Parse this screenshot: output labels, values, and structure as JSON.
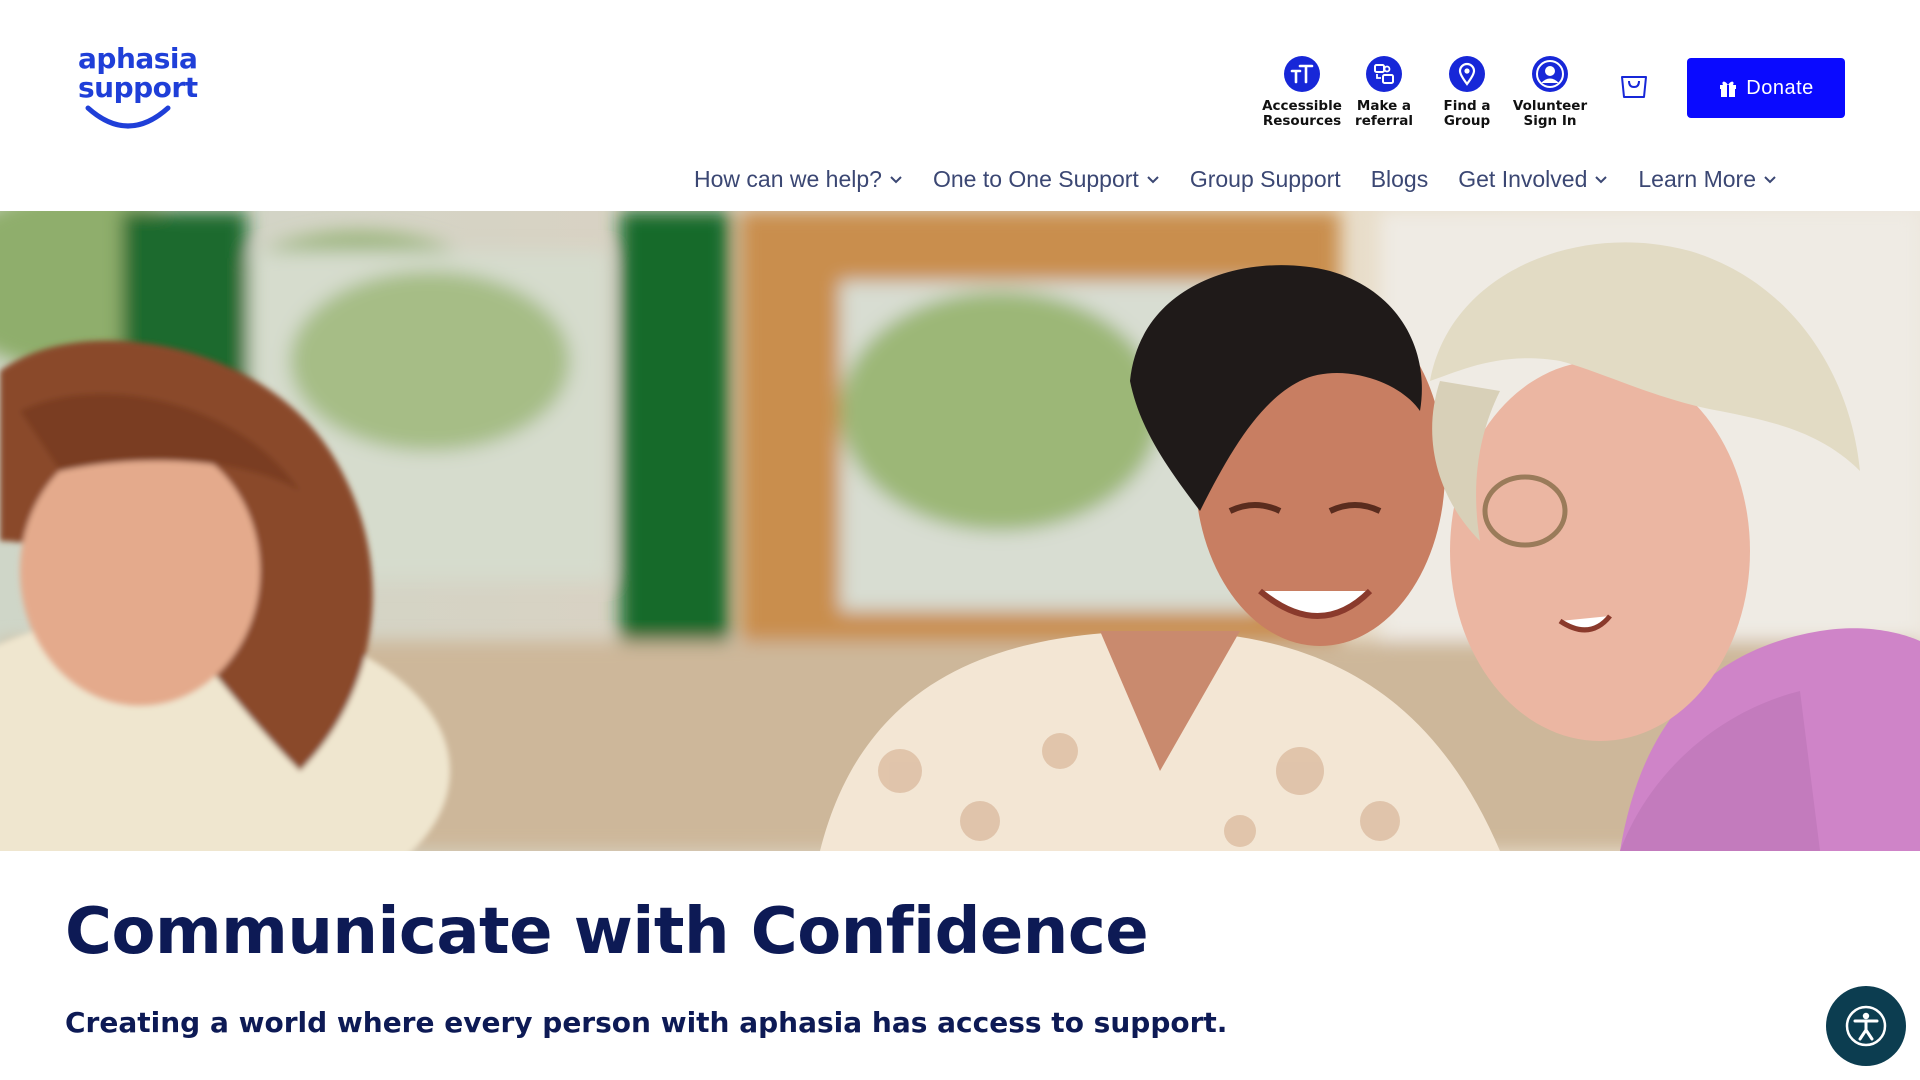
{
  "logo": {
    "line1": "aphasia",
    "line2": "support",
    "color": "#1f3fd8"
  },
  "utility_links": [
    {
      "label": "Accessible\nResources",
      "icon": "text-size-icon"
    },
    {
      "label": "Make a\nreferral",
      "icon": "referral-icon"
    },
    {
      "label": "Find a\nGroup",
      "icon": "map-pin-icon"
    },
    {
      "label": "Volunteer\nSign In",
      "icon": "user-icon"
    }
  ],
  "cart": {
    "icon": "cart-icon"
  },
  "donate": {
    "label": "Donate",
    "icon": "gift-icon",
    "color": "#0a0aff"
  },
  "nav": [
    {
      "label": "How can we help?",
      "has_dropdown": true
    },
    {
      "label": "One to One Support",
      "has_dropdown": true
    },
    {
      "label": "Group Support",
      "has_dropdown": false
    },
    {
      "label": "Blogs",
      "has_dropdown": false
    },
    {
      "label": "Get Involved",
      "has_dropdown": true
    },
    {
      "label": "Learn More",
      "has_dropdown": true
    }
  ],
  "hero": {
    "headline": "Communicate with Confidence",
    "subline": "Creating a world where every person with aphasia has access to support."
  },
  "accessibility_button": {
    "icon": "accessibility-icon",
    "color": "#0c3d50"
  },
  "colors": {
    "heading": "#0d1a55",
    "nav_text": "#3b4773",
    "icon_blue": "#1727d8"
  }
}
